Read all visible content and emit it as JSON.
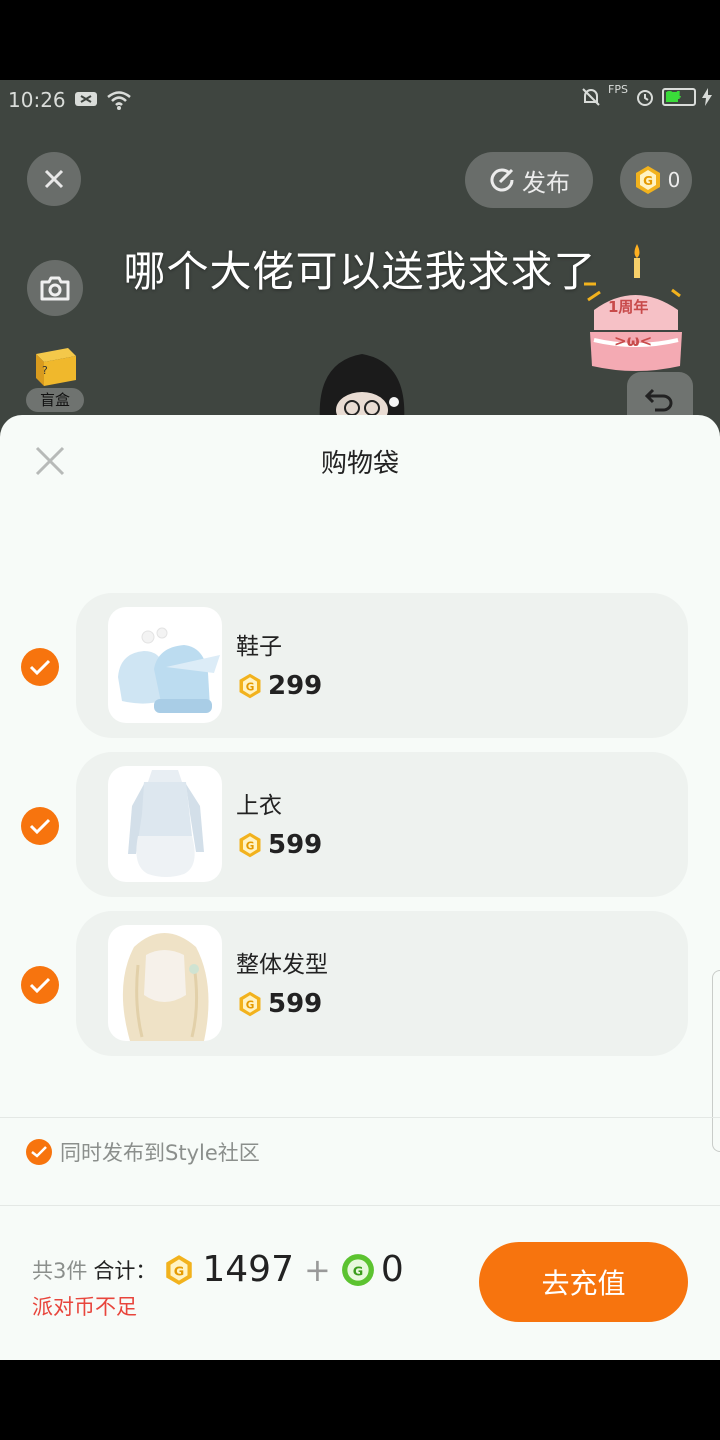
{
  "status_bar": {
    "time": "10:26",
    "fps_label": "FPS",
    "battery": "34"
  },
  "overlay": {
    "publish_label": "发布",
    "coin_balance": "0",
    "caption": "哪个大佬可以送我求求了",
    "blind_box_label": "盲盒",
    "blind_box_mark": "?",
    "cake_label": "1周年",
    "cake_face": ">ω<"
  },
  "cart": {
    "title": "购物袋",
    "items": [
      {
        "name": "鞋子",
        "price": "299"
      },
      {
        "name": "上衣",
        "price": "599"
      },
      {
        "name": "整体发型",
        "price": "599"
      }
    ],
    "publish_checkbox_label": "同时发布到Style社区",
    "item_count": "共3件",
    "total_label": "合计：",
    "total_coins": "1497",
    "plus": "+",
    "green_coins": "0",
    "warning": "派对币不足",
    "recharge_button": "去充值"
  },
  "colors": {
    "accent": "#f7740e",
    "warning": "#e8453c",
    "coin": "#f2b21d",
    "green_coin": "#5cc330"
  }
}
